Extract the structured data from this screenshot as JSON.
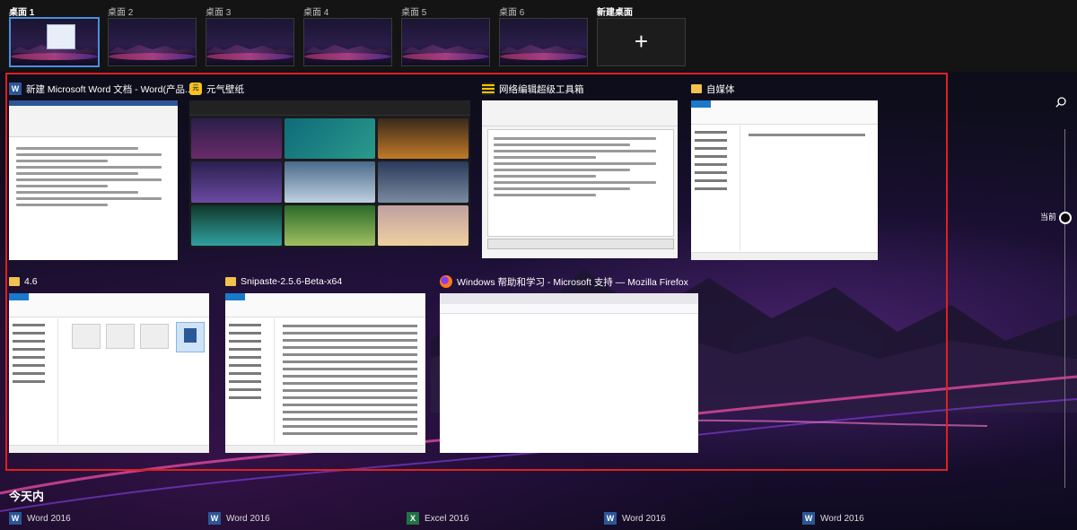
{
  "desktops": {
    "items": [
      {
        "label": "桌面 1",
        "active": true
      },
      {
        "label": "桌面 2",
        "active": false
      },
      {
        "label": "桌面 3",
        "active": false
      },
      {
        "label": "桌面 4",
        "active": false
      },
      {
        "label": "桌面 5",
        "active": false
      },
      {
        "label": "桌面 6",
        "active": false
      }
    ],
    "new_label": "新建桌面",
    "new_icon": "+"
  },
  "windows": [
    {
      "title": "新建 Microsoft Word 文档 - Word(产品...",
      "icon": "word-icon"
    },
    {
      "title": "元气壁纸",
      "icon": "yuanqi-icon"
    },
    {
      "title": "网络编辑超级工具箱",
      "icon": "toolbox-icon"
    },
    {
      "title": "自媒体",
      "icon": "folder-icon"
    },
    {
      "title": "4.6",
      "icon": "folder-icon"
    },
    {
      "title": "Snipaste-2.5.6-Beta-x64",
      "icon": "folder-icon"
    },
    {
      "title": "Windows 帮助和学习 - Microsoft 支持 — Mozilla Firefox",
      "icon": "firefox-icon"
    }
  ],
  "timeline": {
    "current_label": "当前",
    "search_icon": "search-icon"
  },
  "today": {
    "heading": "今天内",
    "items": [
      {
        "label": "Word 2016",
        "icon": "word-icon"
      },
      {
        "label": "Word 2016",
        "icon": "word-icon"
      },
      {
        "label": "Excel 2016",
        "icon": "excel-icon"
      },
      {
        "label": "Word 2016",
        "icon": "word-icon"
      },
      {
        "label": "Word 2016",
        "icon": "word-icon"
      }
    ]
  },
  "colors": {
    "selection_frame": "#e0201e",
    "active_desktop": "#4a8fe0",
    "word": "#2b5797",
    "excel": "#217346"
  }
}
